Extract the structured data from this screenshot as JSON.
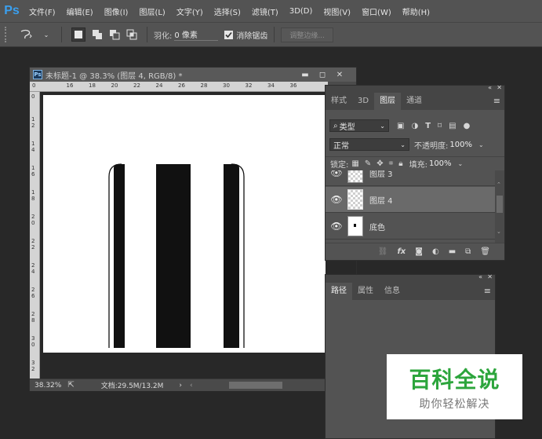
{
  "app": {
    "logo": "Ps",
    "menu": [
      "文件(F)",
      "编辑(E)",
      "图像(I)",
      "图层(L)",
      "文字(Y)",
      "选择(S)",
      "滤镜(T)",
      "3D(D)",
      "视图(V)",
      "窗口(W)",
      "帮助(H)"
    ]
  },
  "options": {
    "feather_label": "羽化:",
    "feather_value": "0 像素",
    "antialias_label": "消除锯齿",
    "refine_edge_button": "调整边缘..."
  },
  "document": {
    "title": "未标题-1 @ 38.3% (图层 4, RGB/8) *",
    "ruler_top_ticks": [
      "0",
      "16",
      "18",
      "20",
      "22",
      "24",
      "26",
      "28",
      "30",
      "32",
      "34",
      "36"
    ],
    "ruler_left_ticks": [
      "0",
      "1 2",
      "1 4",
      "1 6",
      "1 8",
      "2 0",
      "2 2",
      "2 4",
      "2 6",
      "2 8",
      "3 0",
      "3 2"
    ],
    "zoom": "38.32%",
    "doc_info": "文档:29.5M/13.2M",
    "stripe_colors": {
      "black": "#111111",
      "white": "#ffffff"
    }
  },
  "layers_panel": {
    "tabs": [
      "样式",
      "3D",
      "图层",
      "通道"
    ],
    "active_tab": "图层",
    "filter_kind": "类型",
    "blend_mode": "正常",
    "opacity_label": "不透明度:",
    "opacity_value": "100%",
    "lock_label": "锁定:",
    "fill_label": "填充:",
    "fill_value": "100%",
    "layers": [
      {
        "name": "图层 3",
        "selected": false
      },
      {
        "name": "图层 4",
        "selected": true
      },
      {
        "name": "底色",
        "selected": false
      }
    ]
  },
  "paths_panel": {
    "tabs": [
      "路径",
      "属性",
      "信息"
    ],
    "active_tab": "路径"
  },
  "watermark": {
    "title": "百科全说",
    "subtitle": "助你轻松解决"
  },
  "colors": {
    "ui_bg": "#535353",
    "dark_bg": "#282828",
    "selected_layer": "#6a6a6a",
    "watermark_green": "#2ca53c"
  }
}
